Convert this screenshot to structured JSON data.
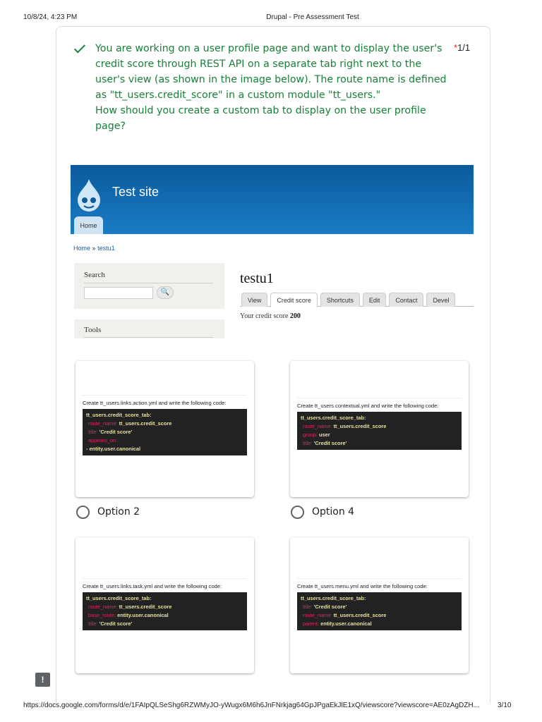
{
  "browser": {
    "datetime": "10/8/24, 4:23 PM",
    "title": "Drupal - Pre Assessment Test",
    "url": "https://docs.google.com/forms/d/e/1FAIpQLSeShg6RZWMyJO-yWugx6M6h6JnFNrkjag64GpJPgaEkJlE1xQ/viewscore?viewscore=AE0zAgDZH...",
    "page": "3/10"
  },
  "question": {
    "text_lines": [
      "You are working on a user profile page and want to display the user's credit score through REST API on a separate tab right next to the user's view (as shown in the image below). The route name is defined as \"tt_users.credit_score\" in a custom module \"tt_users.\"",
      "How should you create a custom tab to display on the user profile page?"
    ],
    "required_mark": "*",
    "score": "1/1",
    "status_color": "#188038"
  },
  "screenshot": {
    "site_name": "Test site",
    "home_tab": "Home",
    "breadcrumb": {
      "home": "Home",
      "sep": "»",
      "current": "testu1"
    },
    "search_label": "Search",
    "search_button": "🔍",
    "tools_label": "Tools",
    "username": "testu1",
    "tabs": [
      "View",
      "Credit score",
      "Shortcuts",
      "Edit",
      "Contact",
      "Devel"
    ],
    "active_tab": "Credit score",
    "credit_text": "Your credit score",
    "credit_value": "200"
  },
  "options": [
    {
      "label": "Option 2",
      "instruction": "Create tt_users.links.action.yml and write the following code:",
      "code": [
        [
          "",
          "tt_users.credit_score_tab:"
        ],
        [
          "route_name:",
          "tt_users.credit_score"
        ],
        [
          "title:",
          "'Credit score'"
        ],
        [
          "appears_on:",
          ""
        ],
        [
          "",
          "  - entity.user.canonical"
        ]
      ]
    },
    {
      "label": "Option 4",
      "instruction": "Create tt_users.contextual.yml and write the following code:",
      "code": [
        [
          "",
          "tt_users.credit_score_tab:"
        ],
        [
          "route_name:",
          "tt_users.credit_score"
        ],
        [
          "group:",
          "user"
        ],
        [
          "title:",
          "'Credit score'"
        ]
      ]
    },
    {
      "label": "",
      "instruction": "Create tt_users.links.task.yml and write the following code:",
      "code": [
        [
          "",
          "tt_users.credit_score_tab:"
        ],
        [
          "route_name:",
          "tt_users.credit_score"
        ],
        [
          "base_route:",
          "entity.user.canonical"
        ],
        [
          "title:",
          "'Credit score'"
        ]
      ]
    },
    {
      "label": "",
      "instruction": "Create tt_users.menu.yml and write the following code:",
      "code": [
        [
          "",
          "tt_users.credit_score_tab:"
        ],
        [
          "title:",
          "'Credit score'"
        ],
        [
          "route_name:",
          "tt_users.credit_score"
        ],
        [
          "parent:",
          "entity.user.canonical"
        ]
      ]
    }
  ],
  "feedback_icon": "report-icon"
}
